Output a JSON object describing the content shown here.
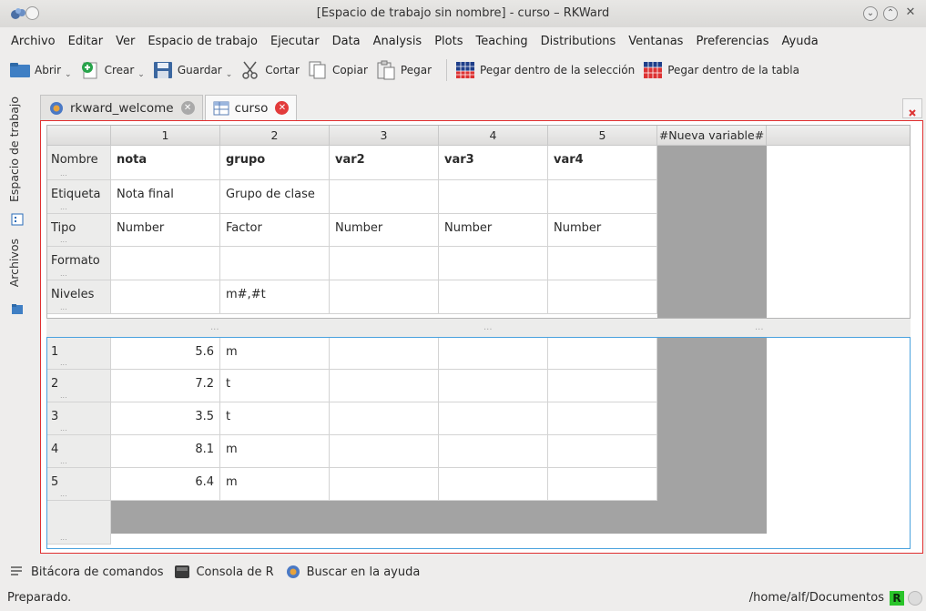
{
  "window": {
    "title": "[Espacio de trabajo sin nombre] - curso – RKWard"
  },
  "menu": [
    "Archivo",
    "Editar",
    "Ver",
    "Espacio de trabajo",
    "Ejecutar",
    "Data",
    "Analysis",
    "Plots",
    "Teaching",
    "Distributions",
    "Ventanas",
    "Preferencias",
    "Ayuda"
  ],
  "toolbar": {
    "abrir": "Abrir",
    "crear": "Crear",
    "guardar": "Guardar",
    "cortar": "Cortar",
    "copiar": "Copiar",
    "pegar": "Pegar",
    "pegar_seleccion": "Pegar dentro de la selección",
    "pegar_tabla": "Pegar dentro de la tabla"
  },
  "side_tabs": {
    "workspace": "Espacio de trabajo",
    "files": "Archivos"
  },
  "tabs": [
    {
      "label": "rkward_welcome",
      "active": false
    },
    {
      "label": "curso",
      "active": true
    }
  ],
  "editor": {
    "column_headers": [
      "1",
      "2",
      "3",
      "4",
      "5",
      "#Nueva variable#"
    ],
    "meta_rows": [
      {
        "label": "Nombre",
        "values": [
          "nota",
          "grupo",
          "var2",
          "var3",
          "var4"
        ]
      },
      {
        "label": "Etiqueta",
        "values": [
          "Nota final",
          "Grupo de clase",
          "",
          "",
          ""
        ]
      },
      {
        "label": "Tipo",
        "values": [
          "Number",
          "Factor",
          "Number",
          "Number",
          "Number"
        ]
      },
      {
        "label": "Formato",
        "values": [
          "",
          "",
          "",
          "",
          ""
        ]
      },
      {
        "label": "Niveles",
        "values": [
          "",
          "m#,#t",
          "",
          "",
          ""
        ]
      }
    ],
    "data_rows": [
      {
        "row": "1",
        "values": [
          "5.6",
          "m",
          "",
          "",
          ""
        ]
      },
      {
        "row": "2",
        "values": [
          "7.2",
          "t",
          "",
          "",
          ""
        ]
      },
      {
        "row": "3",
        "values": [
          "3.5",
          "t",
          "",
          "",
          ""
        ]
      },
      {
        "row": "4",
        "values": [
          "8.1",
          "m",
          "",
          "",
          ""
        ]
      },
      {
        "row": "5",
        "values": [
          "6.4",
          "m",
          "",
          "",
          ""
        ]
      }
    ],
    "dots": "..."
  },
  "bottom_tools": [
    "Bitácora de comandos",
    "Consola de R",
    "Buscar en la ayuda"
  ],
  "status": {
    "left": "Preparado.",
    "path": "/home/alf/Documentos",
    "r_badge": "R"
  },
  "colors": {
    "accent_red": "#e02f2f",
    "focus_blue": "#4aa2de",
    "r_green": "#2ac42a",
    "new_var_gray": "#a3a3a3"
  }
}
